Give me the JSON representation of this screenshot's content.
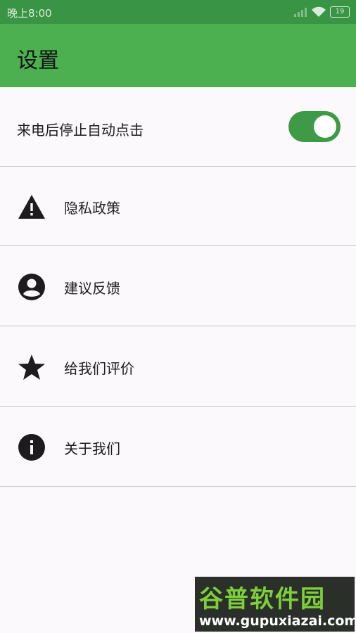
{
  "status_bar": {
    "time": "晚上8:00",
    "battery": "19"
  },
  "app_bar": {
    "title": "设置"
  },
  "settings": {
    "auto_stop": {
      "label": "来电后停止自动点击",
      "enabled": true
    },
    "items": [
      {
        "label": "隐私政策",
        "icon": "warning-icon"
      },
      {
        "label": "建议反馈",
        "icon": "account-circle-icon"
      },
      {
        "label": "给我们评价",
        "icon": "star-icon"
      },
      {
        "label": "关于我们",
        "icon": "info-icon"
      }
    ]
  },
  "watermark": {
    "brand": "谷普软件园",
    "url": "www.gupuxiazai.com"
  },
  "colors": {
    "app_bar": "#4caf50",
    "status_bar": "#3a9446",
    "toggle_on": "#3e9a47"
  }
}
